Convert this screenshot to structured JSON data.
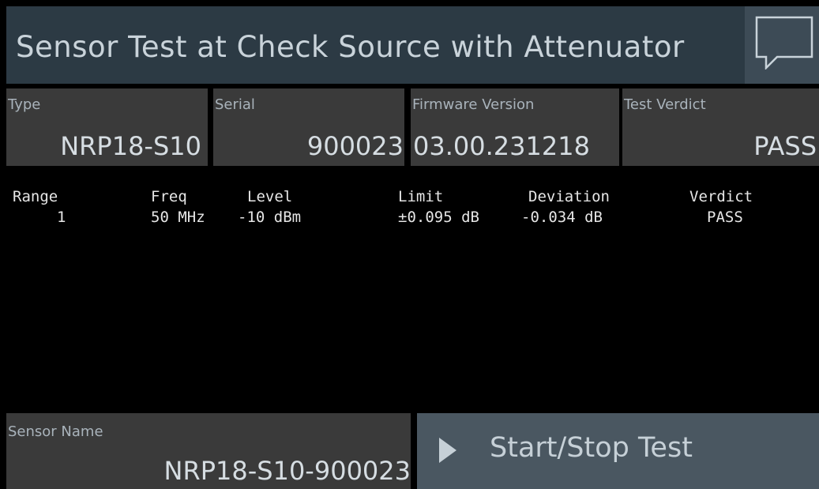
{
  "header": {
    "title": "Sensor Test at Check Source with Attenuator",
    "chat_icon": "speech-bubble-icon"
  },
  "info": {
    "type": {
      "label": "Type",
      "value": "NRP18-S10"
    },
    "serial": {
      "label": "Serial",
      "value": "900023"
    },
    "firmware": {
      "label": "Firmware Version",
      "value": "03.00.231218"
    },
    "verdict": {
      "label": "Test Verdict",
      "value": "PASS"
    }
  },
  "results": {
    "columns": [
      "Range",
      "Freq",
      "Level",
      "Limit",
      "Deviation",
      "Verdict"
    ],
    "rows": [
      [
        "1",
        "50 MHz",
        "-10 dBm",
        "±0.095 dB",
        "-0.034 dB",
        "PASS"
      ]
    ]
  },
  "sensor": {
    "label": "Sensor Name",
    "value": "NRP18-S10-900023"
  },
  "actions": {
    "start_stop_label": "Start/Stop Test",
    "play_icon": "play-icon"
  },
  "colors": {
    "title_bar": "#2c3a44",
    "info_box": "#3a3a3a",
    "button": "#4a5761",
    "text": "#d6dde2"
  }
}
